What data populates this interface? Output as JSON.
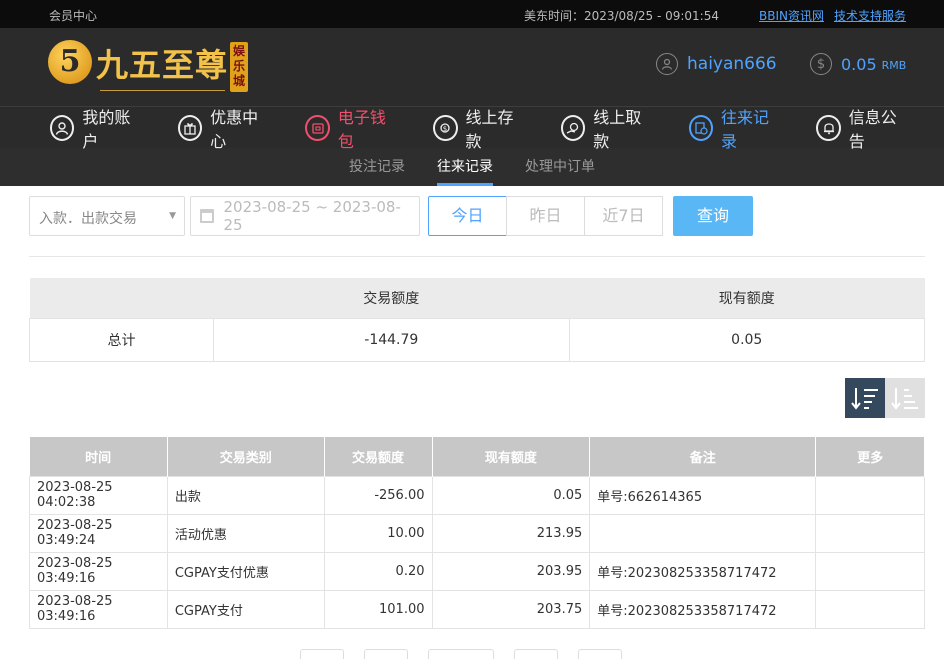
{
  "topbar": {
    "member_center": "会员中心",
    "time_label": "美东时间：2023/08/25 - 09:01:54",
    "links": [
      "BBIN资讯网",
      "技术支持服务"
    ]
  },
  "logo": {
    "mark": "5",
    "name": "九五至尊",
    "tag": "娱乐城"
  },
  "user": {
    "username": "haiyan666",
    "user_icon": "user-icon",
    "balance": "0.05",
    "currency": "RMB",
    "balance_icon": "dollar-icon"
  },
  "nav": {
    "items": [
      {
        "label": "我的账户",
        "icon": "user-icon"
      },
      {
        "label": "优惠中心",
        "icon": "gift-icon"
      },
      {
        "label": "电子钱包",
        "icon": "wallet-icon"
      },
      {
        "label": "线上存款",
        "icon": "deposit-icon"
      },
      {
        "label": "线上取款",
        "icon": "withdraw-icon"
      },
      {
        "label": "往来记录",
        "icon": "records-icon"
      },
      {
        "label": "信息公告",
        "icon": "bell-icon"
      }
    ],
    "active": "往来记录",
    "accent_color": "#4fa3ff",
    "wallet_color": "#f0506e"
  },
  "subnav": {
    "items": [
      "投注记录",
      "往来记录",
      "处理中订单"
    ],
    "active": "往来记录"
  },
  "filter": {
    "type_select": "入款．出款交易",
    "date_range": "2023-08-25 ~ 2023-08-25",
    "ranges": [
      "今日",
      "昨日",
      "近7日"
    ],
    "selected_range": "今日",
    "query_label": "查询"
  },
  "summary": {
    "headers": [
      "",
      "交易额度",
      "现有额度"
    ],
    "row": [
      "总计",
      "-144.79",
      "0.05"
    ]
  },
  "records": {
    "headers": [
      "时间",
      "交易类别",
      "交易额度",
      "现有额度",
      "备注",
      "更多"
    ],
    "rows": [
      [
        "2023-08-25 04:02:38",
        "出款",
        "-256.00",
        "0.05",
        "单号:662614365",
        ""
      ],
      [
        "2023-08-25 03:49:24",
        "活动优惠",
        "10.00",
        "213.95",
        "",
        ""
      ],
      [
        "2023-08-25 03:49:16",
        "CGPAY支付优惠",
        "0.20",
        "203.95",
        "单号:202308253358717472",
        ""
      ],
      [
        "2023-08-25 03:49:16",
        "CGPAY支付",
        "101.00",
        "203.75",
        "单号:202308253358717472",
        ""
      ]
    ]
  }
}
